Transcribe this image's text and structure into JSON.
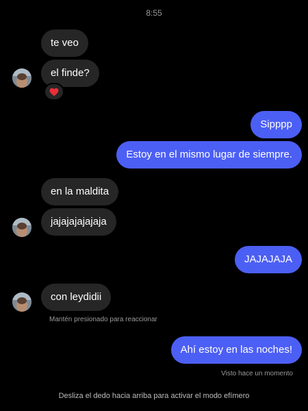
{
  "status_bar": {
    "time": "8:55"
  },
  "messages": {
    "m1": "te veo",
    "m2": "el finde?",
    "m3": "Sipppp",
    "m4": "Estoy en el mismo lugar de siempre.",
    "m5": "en la  maldita",
    "m6": "jajajajajajaja",
    "m7": "JAJAJAJA",
    "m8": "con leydidii",
    "m9": "Ahí estoy en las noches!"
  },
  "reaction_emoji": "heart",
  "hints": {
    "react": "Mantén presionado para reaccionar",
    "seen": "Visto hace un momento"
  },
  "footer": "Desliza el dedo hacia arriba para activar el modo efímero",
  "colors": {
    "outgoing_bubble": "#4c5ff4",
    "incoming_bubble": "#262626",
    "background": "#000000"
  }
}
